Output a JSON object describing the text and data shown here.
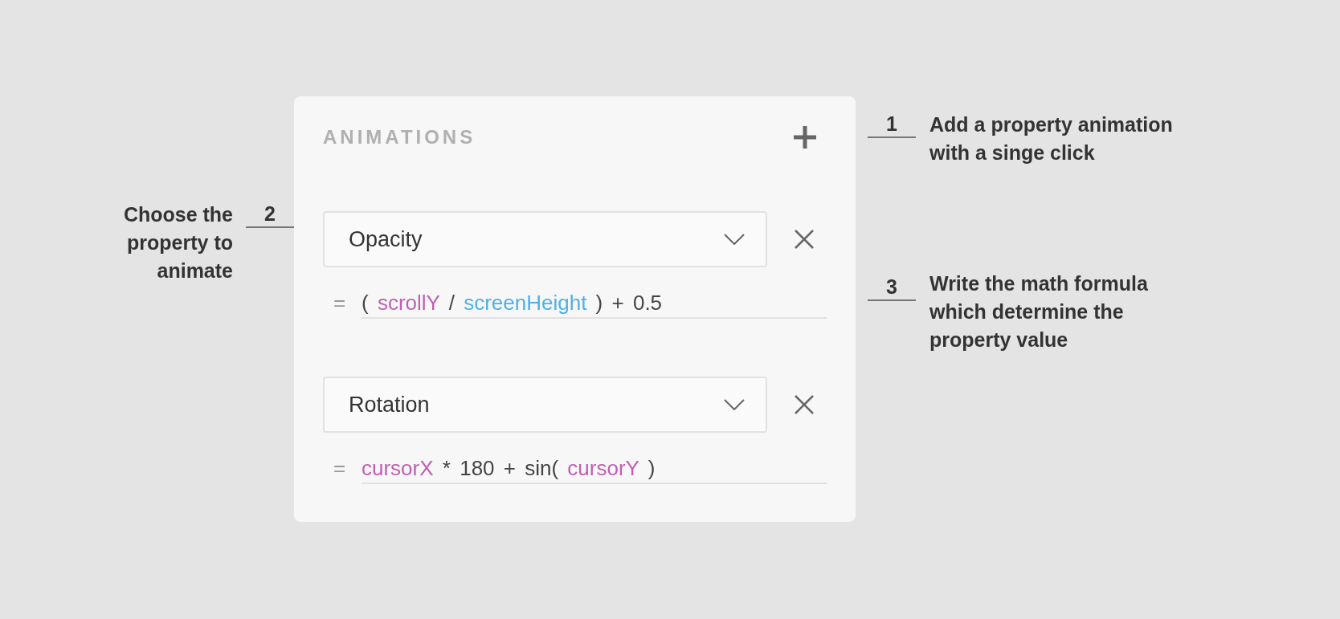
{
  "panel": {
    "title": "ANIMATIONS",
    "items": [
      {
        "property": "Opacity",
        "formula": [
          {
            "kind": "operator",
            "text": "("
          },
          {
            "kind": "variable",
            "text": "scrollY",
            "color": "#c05fb5"
          },
          {
            "kind": "operator",
            "text": "/"
          },
          {
            "kind": "variable",
            "text": "screenHeight",
            "color": "#4fb0e8"
          },
          {
            "kind": "operator",
            "text": ")"
          },
          {
            "kind": "operator",
            "text": "+"
          },
          {
            "kind": "operator",
            "text": "0.5"
          }
        ]
      },
      {
        "property": "Rotation",
        "formula": [
          {
            "kind": "variable",
            "text": "cursorX",
            "color": "#c05fb5"
          },
          {
            "kind": "operator",
            "text": "*"
          },
          {
            "kind": "operator",
            "text": "180"
          },
          {
            "kind": "operator",
            "text": "+"
          },
          {
            "kind": "operator",
            "text": "sin("
          },
          {
            "kind": "variable",
            "text": "cursorY",
            "color": "#c05fb5"
          },
          {
            "kind": "operator",
            "text": ")"
          }
        ]
      }
    ],
    "equals": "="
  },
  "left_annotations": [
    {
      "number": "2",
      "text": "Choose the property to animate"
    }
  ],
  "right_annotations": [
    {
      "number": "1",
      "text": "Add a property animation with a singe click"
    },
    {
      "number": "3",
      "text": "Write the math formula which determine the property value"
    }
  ]
}
